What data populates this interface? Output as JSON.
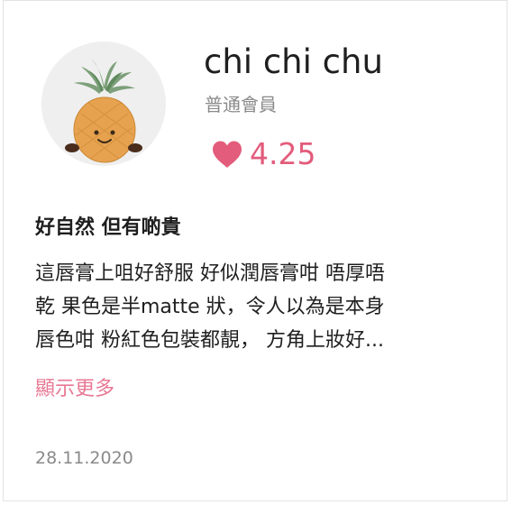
{
  "user": {
    "name": "chi chi chu",
    "level": "普通會員",
    "rating": "4.25",
    "avatar_icon": "pineapple-plush-icon"
  },
  "review": {
    "title": "好自然 但有啲貴",
    "lines": [
      "這唇膏上咀好舒服 好似潤唇膏咁 唔厚唔",
      "乾 果色是半matte 狀，令人以為是本身",
      "唇色咁 粉紅色包裝都靚， 方角上妝好..."
    ],
    "show_more_label": "顯示更多",
    "date": "28.11.2020"
  },
  "colors": {
    "accent": "#e35c7b",
    "link": "#e87894",
    "muted": "#8a8a8a",
    "text": "#1f1f1f"
  }
}
